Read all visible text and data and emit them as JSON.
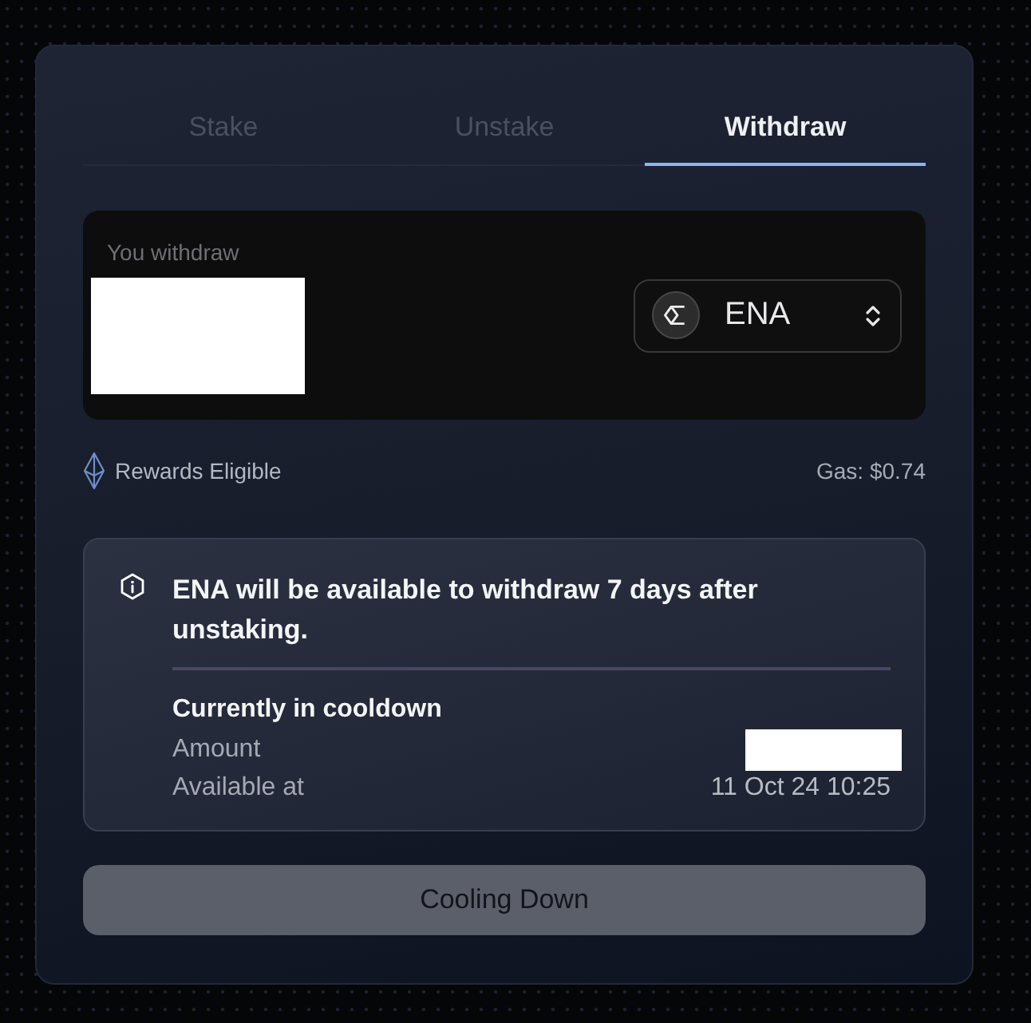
{
  "tabs": [
    {
      "label": "Stake",
      "selected": false
    },
    {
      "label": "Unstake",
      "selected": false
    },
    {
      "label": "Withdraw",
      "selected": true
    }
  ],
  "amount_input": {
    "label": "You withdraw",
    "redacted": true,
    "token": "ENA"
  },
  "rewards": {
    "label": "Rewards Eligible"
  },
  "gas": "Gas: $0.74",
  "notice": {
    "message": "ENA will be available to withdraw 7 days after unstaking.",
    "title": "Currently in cooldown",
    "rows": [
      {
        "label": "Amount",
        "redacted": true
      },
      {
        "label": "Available at",
        "value": "11 Oct 24 10:25"
      }
    ]
  },
  "action_button": {
    "label": "Cooling Down",
    "disabled": true
  }
}
